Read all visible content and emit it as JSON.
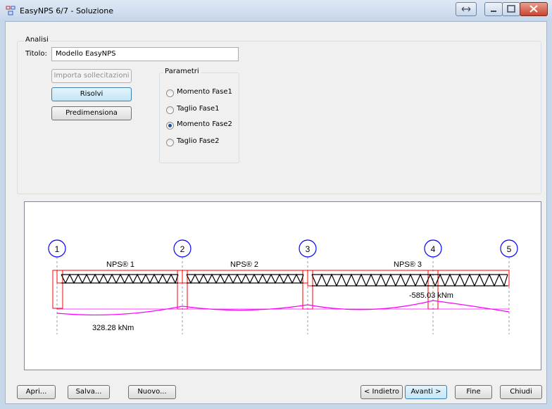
{
  "window": {
    "title": "EasyNPS 6/7 - Soluzione"
  },
  "analisi": {
    "group_label": "Analisi",
    "titolo_label": "Titolo:",
    "titolo_value": "Modello EasyNPS",
    "buttons": {
      "importa": "Importa sollecitazioni",
      "risolvi": "Risolvi",
      "predimensiona": "Predimensiona"
    },
    "parametri": {
      "label": "Parametri",
      "options": [
        "Momento Fase1",
        "Taglio Fase1",
        "Momento Fase2",
        "Taglio Fase2"
      ],
      "selected": "Momento Fase2"
    }
  },
  "diagram": {
    "supports": [
      "1",
      "2",
      "3",
      "4",
      "5"
    ],
    "spans": [
      "NPS® 1",
      "NPS® 2",
      "NPS® 3"
    ],
    "annotations": {
      "positive_moment": "328.28 kNm",
      "negative_moment": "-585.03 kNm"
    },
    "colors": {
      "beam": "#ff0000",
      "truss": "#000000",
      "moment": "#ff00ff",
      "support": "#0000ff"
    }
  },
  "footer": {
    "apri": "Apri...",
    "salva": "Salva...",
    "nuovo": "Nuovo...",
    "indietro": "< Indietro",
    "avanti": "Avanti >",
    "fine": "Fine",
    "chiudi": "Chiudi"
  }
}
